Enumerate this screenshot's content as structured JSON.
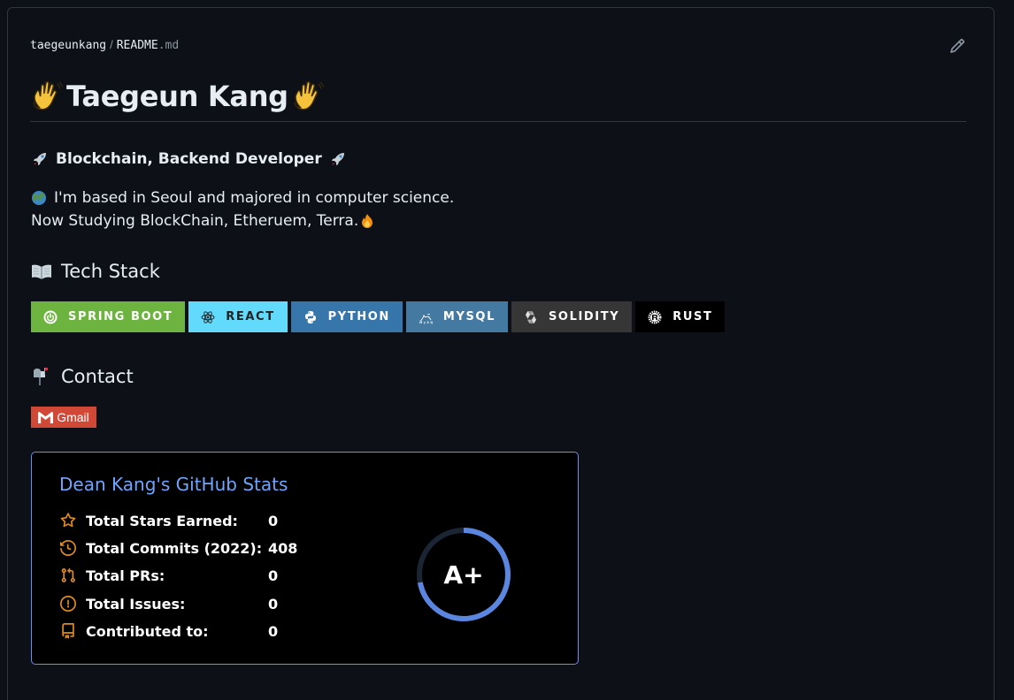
{
  "file": {
    "owner": "taegeunkang",
    "separator": "/",
    "name": "README",
    "ext": ".md"
  },
  "title": "Taegeun Kang",
  "role": "Blockchain, Backend Developer",
  "bio": {
    "line1": "I'm based in Seoul and majored in computer science.",
    "line2": "Now Studying BlockChain, Etheruem, Terra."
  },
  "sections": {
    "tech": "Tech Stack",
    "contact": "Contact"
  },
  "badges": [
    {
      "label": "SPRING BOOT",
      "color": "#6db33f",
      "icon": "spring-icon"
    },
    {
      "label": "REACT",
      "color": "#61dafb",
      "icon": "react-icon"
    },
    {
      "label": "PYTHON",
      "color": "#3776ab",
      "icon": "python-icon"
    },
    {
      "label": "MYSQL",
      "color": "#4479a1",
      "icon": "mysql-icon"
    },
    {
      "label": "SOLIDITY",
      "color": "#363636",
      "icon": "solidity-icon"
    },
    {
      "label": "RUST",
      "color": "#000000",
      "icon": "rust-icon"
    }
  ],
  "gmail": {
    "label": "Gmail",
    "color": "#d14836",
    "icon": "gmail-icon"
  },
  "stats": {
    "title": "Dean Kang's GitHub Stats",
    "rows": [
      {
        "label": "Total Stars Earned:",
        "value": "0",
        "icon": "star-icon"
      },
      {
        "label": "Total Commits (2022):",
        "value": "408",
        "icon": "history-icon"
      },
      {
        "label": "Total PRs:",
        "value": "0",
        "icon": "pull-request-icon"
      },
      {
        "label": "Total Issues:",
        "value": "0",
        "icon": "issue-icon"
      },
      {
        "label": "Contributed to:",
        "value": "0",
        "icon": "repo-icon"
      }
    ],
    "rank": "A+",
    "rank_progress": 0.72,
    "accent": "#70a5fd",
    "icon_color": "#e08a1e"
  }
}
